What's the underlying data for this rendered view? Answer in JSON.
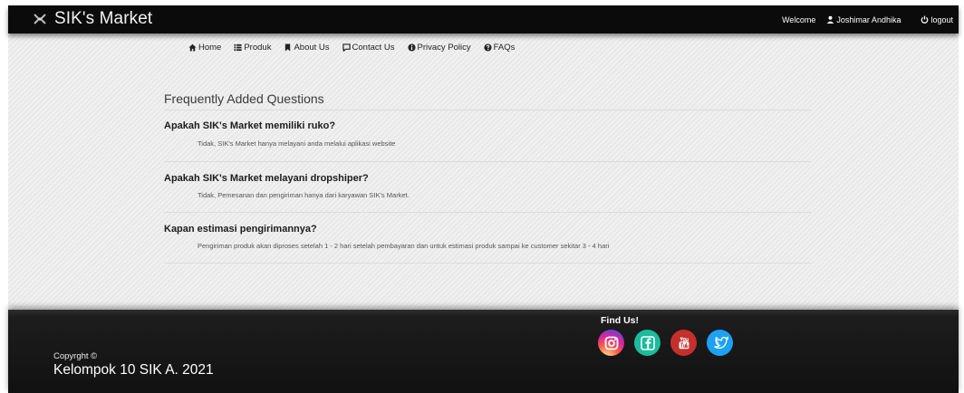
{
  "header": {
    "brand": "SIK's Market",
    "welcome": "Welcome",
    "user": "Joshimar Andhika",
    "logout": "logout"
  },
  "nav": [
    {
      "label": "Home",
      "icon": "home-icon"
    },
    {
      "label": "Produk",
      "icon": "list-icon"
    },
    {
      "label": "About Us",
      "icon": "bookmark-icon"
    },
    {
      "label": "Contact Us",
      "icon": "chat-icon"
    },
    {
      "label": "Privacy Policy",
      "icon": "info-icon"
    },
    {
      "label": "FAQs",
      "icon": "question-icon"
    }
  ],
  "faq": {
    "title": "Frequently Added Questions",
    "items": [
      {
        "q": "Apakah SIK's Market memiliki ruko?",
        "a": "Tidak, SIK's Market hanya melayani anda melalui aplikasi website"
      },
      {
        "q": "Apakah SIK's Market melayani dropshiper?",
        "a": "Tidak, Pemesanan dan pengiriman hanya dari karyawan SIK's Market."
      },
      {
        "q": "Kapan estimasi pengirimannya?",
        "a": "Pengiriman produk akan diproses setelah 1 - 2 hari setelah pembayaran dan untuk estimasi produk sampai ke customer sekitar 3 - 4 hari"
      }
    ]
  },
  "footer": {
    "copyright": "Copyrght ©",
    "team": "Kelompok 10 SIK A. 2021",
    "find_us": "Find Us!",
    "social": [
      {
        "name": "instagram-icon",
        "color": "#c13584"
      },
      {
        "name": "facebook-icon",
        "color": "#1abc9c"
      },
      {
        "name": "youtube-icon",
        "color": "#c4302b"
      },
      {
        "name": "twitter-icon",
        "color": "#1da1f2"
      }
    ]
  },
  "colors": {
    "topbar": "#0b0b0b",
    "main_bg": "#ececec",
    "footer": "#111111"
  }
}
